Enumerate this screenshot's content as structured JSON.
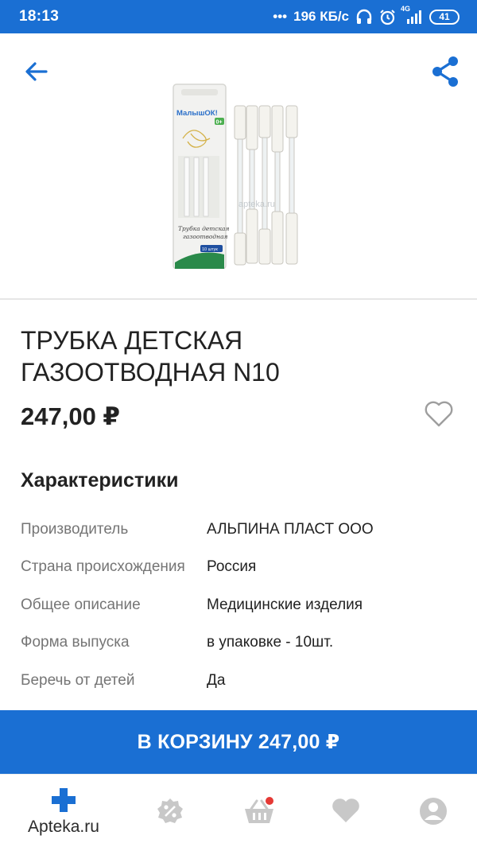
{
  "status_bar": {
    "time": "18:13",
    "network_speed": "196 КБ/с",
    "network_type": "4G",
    "battery": "41"
  },
  "colors": {
    "brand_blue": "#1a6fd3",
    "text_primary": "#222222",
    "text_secondary": "#757575",
    "notification_dot": "#e53935"
  },
  "top_bar": {
    "back_icon": "arrow-left-icon",
    "share_icon": "share-icon"
  },
  "product": {
    "image_brand": "МалышОК!",
    "image_age": "0+",
    "image_caption_line1": "Трубка детская",
    "image_caption_line2": "газоотводная",
    "image_badge": "10 штук",
    "image_watermark": "apteka.ru",
    "title": "ТРУБКА ДЕТСКАЯ ГАЗООТВОДНАЯ N10",
    "price": "247,00 ₽",
    "favorite_icon": "heart-outline-icon"
  },
  "characteristics": {
    "heading": "Характеристики",
    "rows": [
      {
        "label": "Производитель",
        "value": "АЛЬПИНА ПЛАСТ ООО"
      },
      {
        "label": "Страна происхождения",
        "value": "Россия"
      },
      {
        "label": "Общее описание",
        "value": "Медицинские изделия"
      },
      {
        "label": "Форма выпуска",
        "value": "в упаковке - 10шт."
      },
      {
        "label": "Беречь от детей",
        "value": "Да"
      }
    ]
  },
  "cart_button": {
    "label": "В КОРЗИНУ 247,00 ₽"
  },
  "bottom_nav": {
    "home_label": "Apteka.ru",
    "items": [
      "home-cross-icon",
      "discount-icon",
      "basket-icon",
      "heart-icon",
      "profile-icon"
    ]
  }
}
